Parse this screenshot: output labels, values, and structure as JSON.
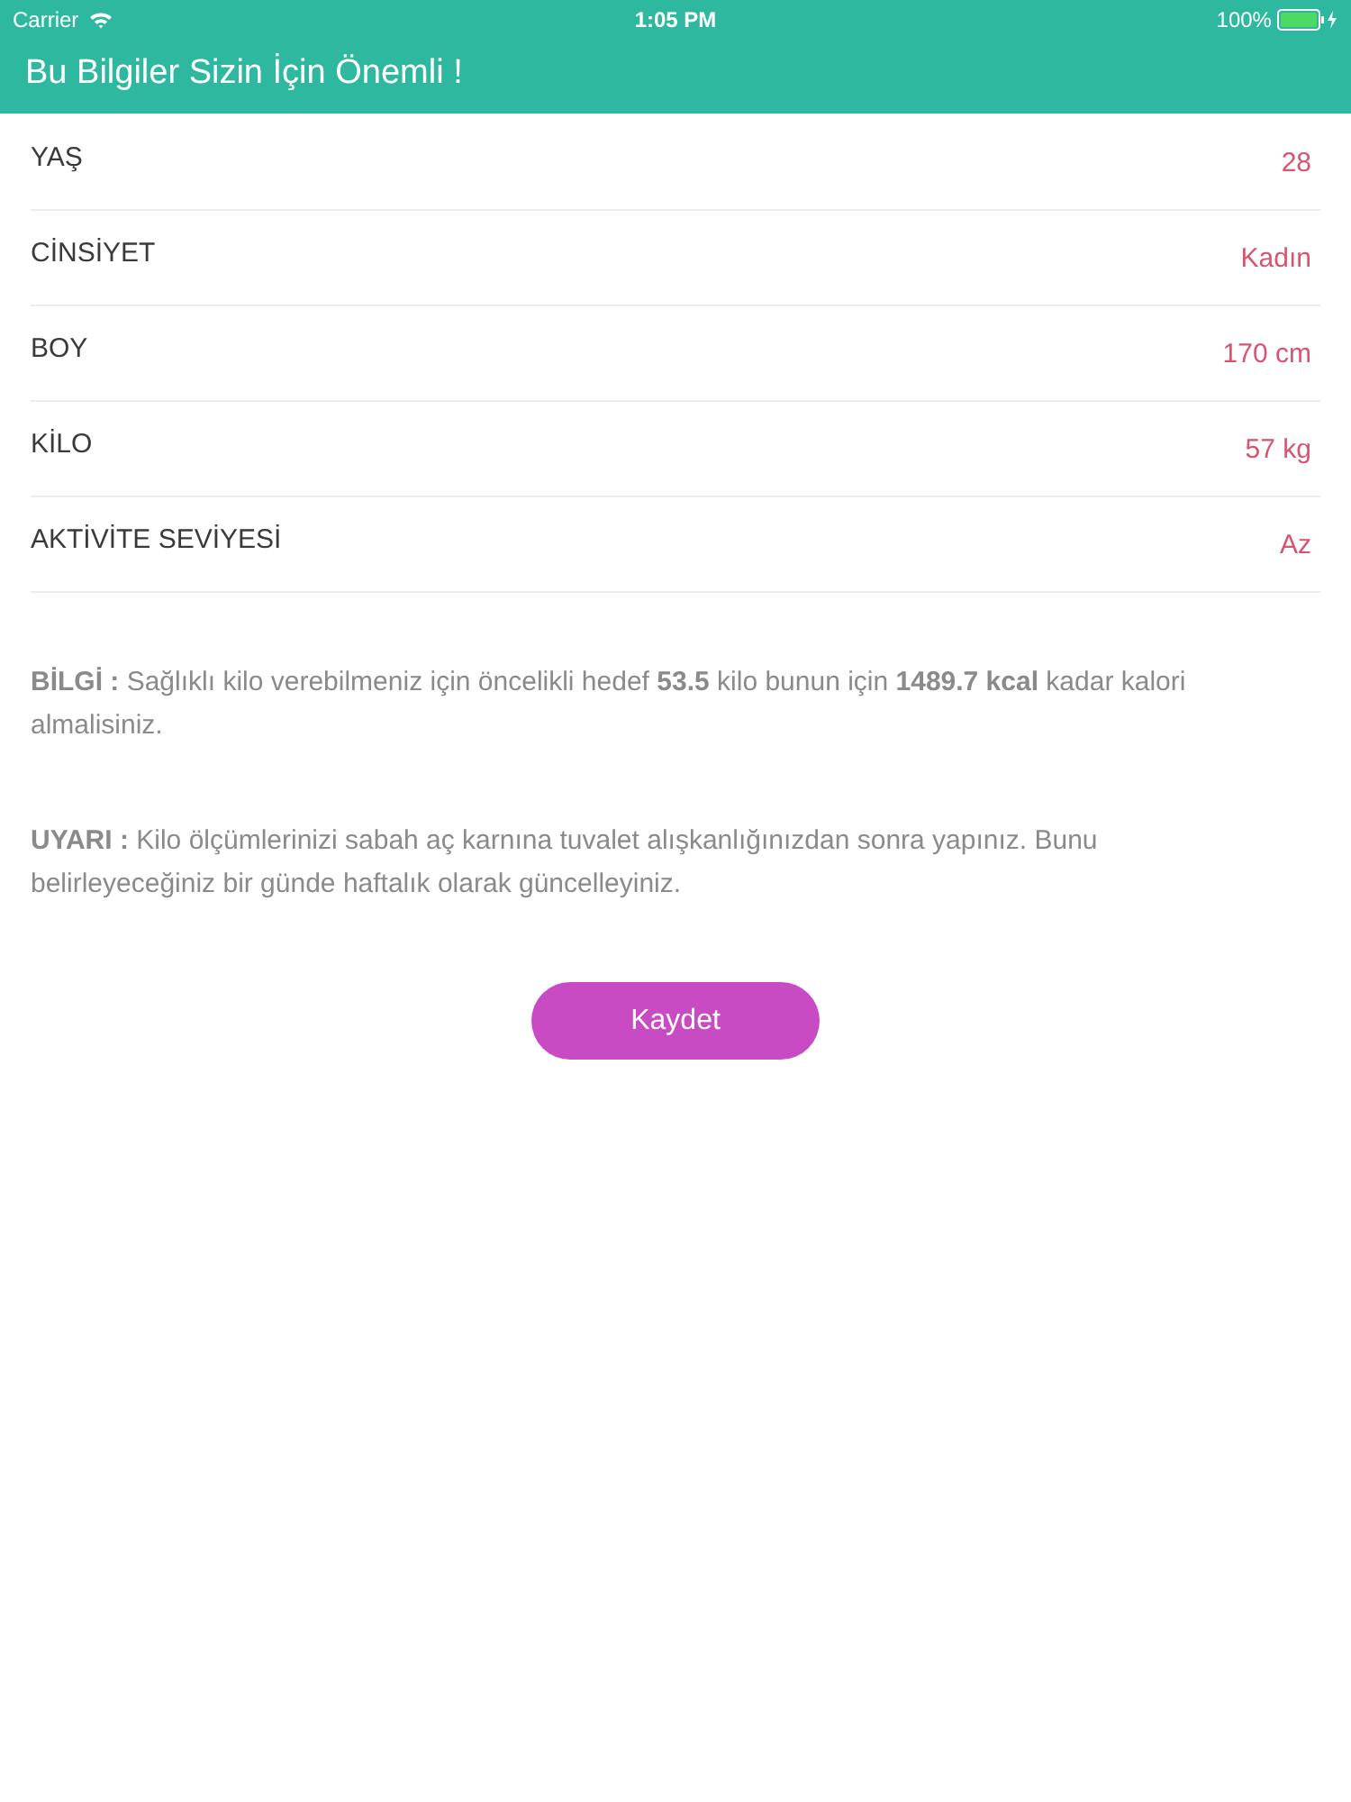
{
  "status_bar": {
    "carrier": "Carrier",
    "time": "1:05 PM",
    "battery": "100%"
  },
  "header": {
    "title": "Bu Bilgiler Sizin İçin Önemli !"
  },
  "rows": [
    {
      "label": "YAŞ",
      "value": "28"
    },
    {
      "label": "CİNSİYET",
      "value": "Kadın"
    },
    {
      "label": "BOY",
      "value": "170 cm"
    },
    {
      "label": "KİLO",
      "value": "57 kg"
    },
    {
      "label": "AKTİVİTE SEVİYESİ",
      "value": "Az"
    }
  ],
  "notes": [
    "**BİLGİ :** Sağlıklı kilo verebilmeniz için öncelikli hedef **53.5** kilo bunun için **1489.7 kcal** kadar kalori almalisiniz.",
    "**UYARI :** Kilo ölçümlerinizi sabah aç karnına tuvalet alışkanlığınızdan sonra yapınız. Bunu belirleyeceğiniz bir günde haftalık olarak güncelleyiniz."
  ],
  "save_button": {
    "label": "Kaydet"
  }
}
